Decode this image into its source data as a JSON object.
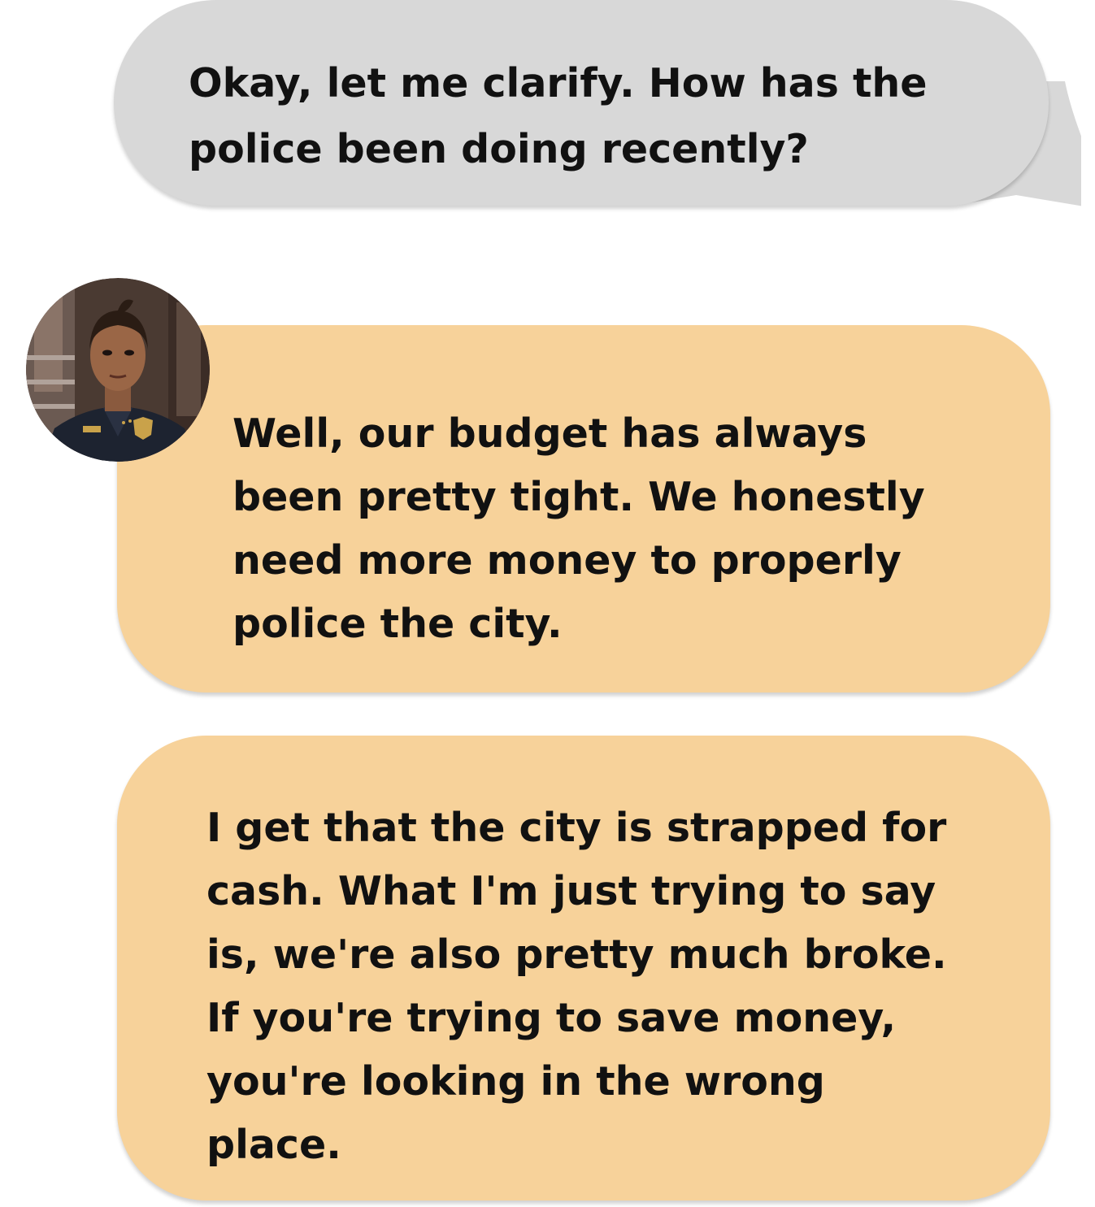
{
  "conversation": {
    "messages": [
      {
        "sender": "user",
        "text": "Okay, let me clarify. How has the\npolice been doing recently?"
      },
      {
        "sender": "police-chief",
        "text": "Well, our budget has always\nbeen pretty tight. We honestly\nneed more money to properly\npolice the city."
      },
      {
        "sender": "police-chief",
        "text": "I get that the city is strapped for\ncash. What I'm just trying to say\nis, we're also pretty much broke.\nIf you're trying to save money,\nyou're looking in the wrong\nplace."
      }
    ]
  },
  "colors": {
    "outgoing_bubble": "#d8d8d8",
    "incoming_bubble": "#f7d29a",
    "text": "#111111"
  },
  "avatar": {
    "icon": "police-officer-avatar"
  }
}
